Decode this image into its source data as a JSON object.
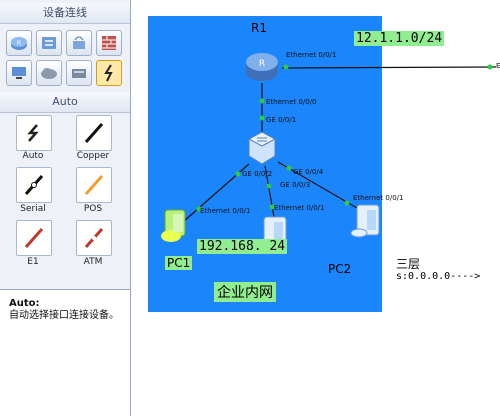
{
  "sidebar": {
    "title": "设备连线",
    "section": "Auto",
    "device_icons": [
      "router-icon",
      "switch-icon",
      "wireless-icon",
      "firewall-icon",
      "pc-icon",
      "cloud-icon",
      "hub-icon",
      "connection-icon"
    ],
    "cables": [
      {
        "label": "Auto",
        "icon": "auto-cable-icon",
        "color": "#222222"
      },
      {
        "label": "Copper",
        "icon": "copper-cable-icon",
        "color": "#111111"
      },
      {
        "label": "Serial",
        "icon": "serial-cable-icon",
        "color": "#111111"
      },
      {
        "label": "POS",
        "icon": "pos-cable-icon",
        "color": "#f0a030"
      },
      {
        "label": "E1",
        "icon": "e1-cable-icon",
        "color": "#c0392b"
      },
      {
        "label": "ATM",
        "icon": "atm-cable-icon",
        "color": "#c0392b"
      }
    ],
    "description_title": "Auto:",
    "description_text": "自动选择接口连接设备。"
  },
  "topology": {
    "router_name": "R1",
    "network_wan": "12.1.1.0/24",
    "network_lan": "192.168.   24",
    "area_label": "企业内网",
    "pc1_name": "PC1",
    "pc2_name": "PC2",
    "ports": {
      "r1_wan": "Ethernet 0/0/1",
      "r1_lan": "Ethernet 0/0/0",
      "sw_up": "GE 0/0/1",
      "sw_pc1": "GE 0/0/2",
      "sw_pc3": "GE 0/0/3",
      "sw_pc2": "GE 0/0/4",
      "pc1_eth": "Ethernet 0/0/1",
      "pc3_eth": "Ethernet 0/0/1",
      "pc2_eth": "Ethernet 0/0/1",
      "edge_port": "E"
    },
    "note_line1": "三层",
    "note_line2": "s:0.0.0.0---->"
  },
  "colors": {
    "area": "#1b86fb",
    "network_label_bg": "#90ee90",
    "link_dot": "#2ecc40"
  }
}
